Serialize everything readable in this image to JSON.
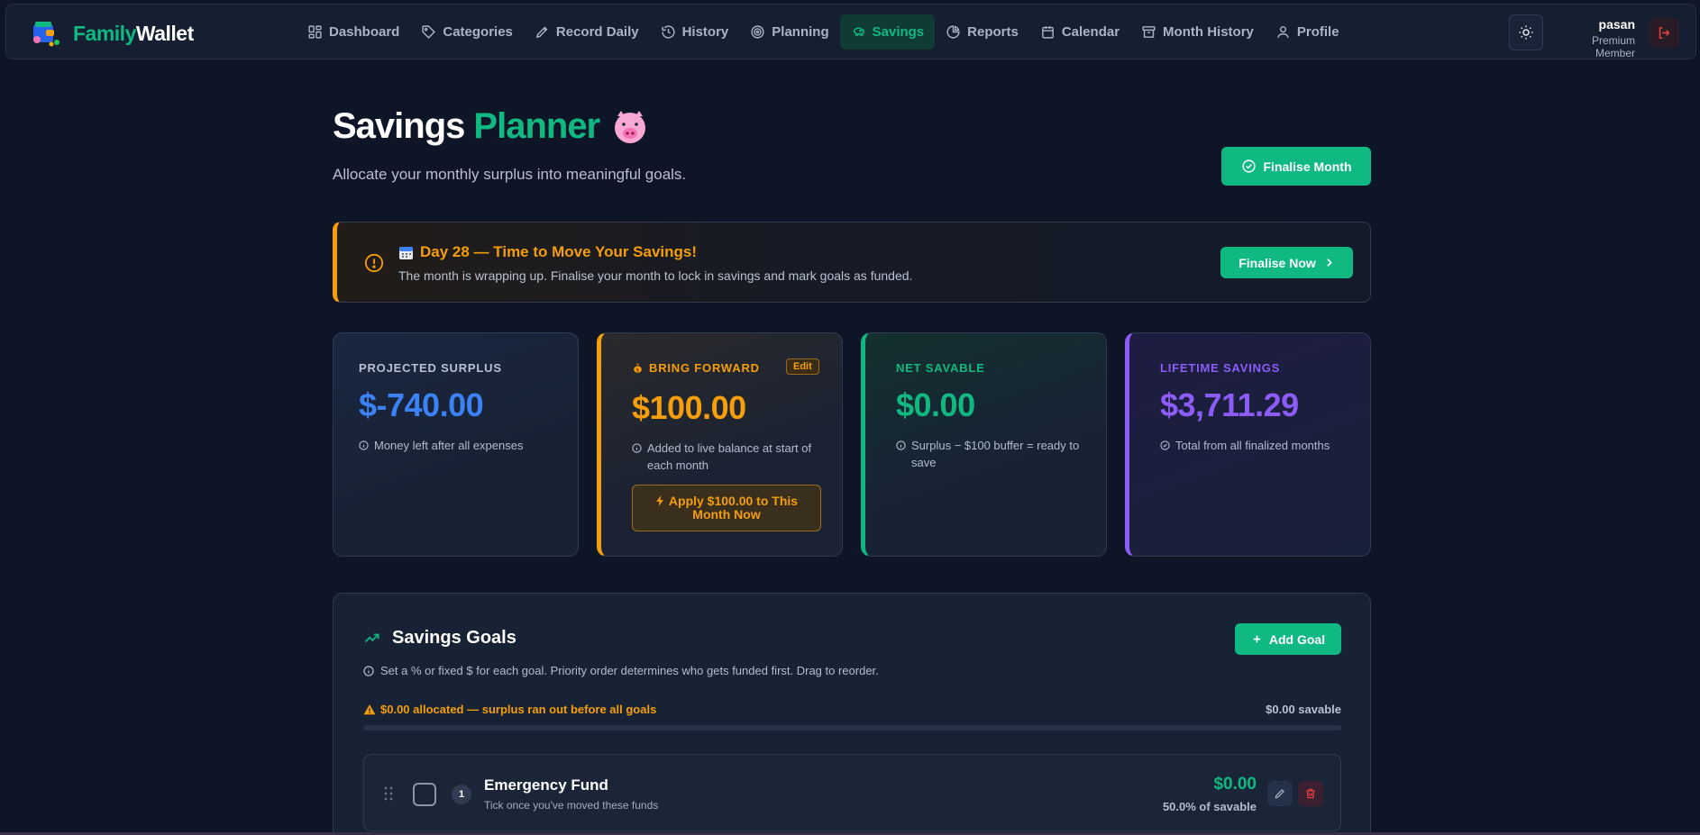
{
  "brand": {
    "part1": "Family",
    "part2": "Wallet"
  },
  "nav": {
    "items": [
      {
        "label": "Dashboard",
        "icon": "grid-icon"
      },
      {
        "label": "Categories",
        "icon": "tag-icon"
      },
      {
        "label": "Record Daily",
        "icon": "pencil-icon"
      },
      {
        "label": "History",
        "icon": "history-icon"
      },
      {
        "label": "Planning",
        "icon": "target-icon"
      },
      {
        "label": "Savings",
        "icon": "piggy-bank-icon",
        "active": true
      },
      {
        "label": "Reports",
        "icon": "pie-chart-icon"
      },
      {
        "label": "Calendar",
        "icon": "calendar-icon"
      },
      {
        "label": "Month History",
        "icon": "archive-icon"
      },
      {
        "label": "Profile",
        "icon": "user-icon"
      }
    ]
  },
  "user": {
    "name": "pasan",
    "role": "Premium Member"
  },
  "header": {
    "title_main": "Savings",
    "title_accent": "Planner",
    "subtitle": "Allocate your monthly surplus into meaningful goals.",
    "finalise_button": "Finalise Month"
  },
  "banner": {
    "title": "Day 28 — Time to Move Your Savings!",
    "text": "The month is wrapping up. Finalise your month to lock in savings and mark goals as funded.",
    "button": "Finalise Now"
  },
  "stats": {
    "projected": {
      "label": "PROJECTED SURPLUS",
      "value": "$-740.00",
      "note": "Money left after all expenses"
    },
    "bring_forward": {
      "label": "BRING FORWARD",
      "edit": "Edit",
      "value": "$100.00",
      "note": "Added to live balance at start of each month",
      "apply_button": "Apply $100.00 to This Month Now"
    },
    "net_savable": {
      "label": "NET SAVABLE",
      "value": "$0.00",
      "note": "Surplus − $100 buffer = ready to save"
    },
    "lifetime": {
      "label": "LIFETIME SAVINGS",
      "value": "$3,711.29",
      "note": "Total from all finalized months"
    }
  },
  "goals": {
    "title": "Savings Goals",
    "add_button": "Add Goal",
    "hint": "Set a % or fixed $ for each goal. Priority order determines who gets funded first. Drag to reorder.",
    "allocation_warning": "$0.00 allocated — surplus ran out before all goals",
    "savable_total": "$0.00 savable",
    "allocated_fraction": 0,
    "items": [
      {
        "priority": "1",
        "name": "Emergency Fund",
        "subtitle": "Tick once you've moved these funds",
        "amount": "$0.00",
        "share": "50.0% of savable",
        "checked": false
      }
    ]
  },
  "colors": {
    "background": "#0d1527",
    "accent_green": "#10b981",
    "accent_amber": "#f59e0b",
    "accent_blue": "#3b82f6",
    "accent_purple": "#8b5cf6",
    "danger": "#ef4444"
  }
}
